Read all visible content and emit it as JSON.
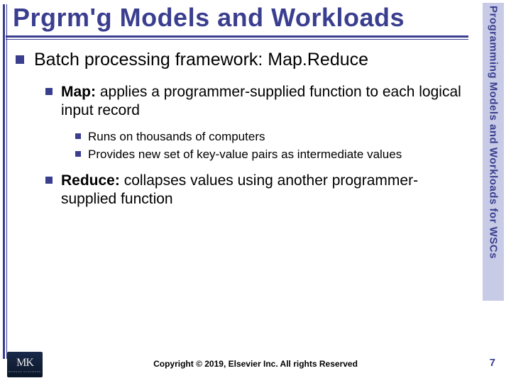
{
  "title": "Prgrm'g Models and Workloads",
  "sidebar": "Programming Models and Workloads for WSCs",
  "b1": {
    "text": "Batch processing framework:  Map.Reduce"
  },
  "b2a": {
    "lead": "Map:",
    "rest": "  applies a programmer-supplied function to each logical input record"
  },
  "b3a": {
    "text": "Runs on thousands of computers"
  },
  "b3b": {
    "text": "Provides new set of key-value pairs as intermediate values"
  },
  "b2b": {
    "lead": "Reduce:",
    "rest": "  collapses values using another programmer-supplied function"
  },
  "footer": {
    "logo_main": "MK",
    "logo_sub": "MORGAN KAUFMANN",
    "copyright": "Copyright © 2019, Elsevier Inc. All rights Reserved",
    "page": "7"
  }
}
